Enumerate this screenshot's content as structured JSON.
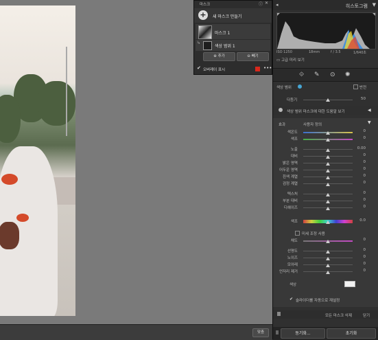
{
  "mask_panel": {
    "title": "마스크",
    "new_mask": "새 마스크 만들기",
    "mask1": "마스크 1",
    "sub_mask": "색상 범위 1",
    "add": "추가",
    "subtract": "빼기",
    "overlay_label": "오버레이 표시",
    "overlay_color": "#d8281c"
  },
  "histogram": {
    "title": "히스토그램",
    "iso": "ISO 1250",
    "focal": "18mm",
    "aperture": "f / 3.5",
    "shutter": "1/640초",
    "original": "고급 미리 보기"
  },
  "color_range": {
    "label": "색상 범위",
    "invert": "반전",
    "refine_label": "다듬기",
    "refine_value": "50",
    "help": "색상 범위 마스크에 대한 도움말 보기"
  },
  "effect": {
    "label": "효과",
    "preset": "사용자 정의",
    "sliders": [
      {
        "label": "색온도",
        "value": "0"
      },
      {
        "label": "색조",
        "value": "0"
      },
      {
        "label": "노출",
        "value": "0.00"
      },
      {
        "label": "대비",
        "value": "0"
      },
      {
        "label": "밝은 영역",
        "value": "0"
      },
      {
        "label": "어두운 영역",
        "value": "0"
      },
      {
        "label": "흰색 계열",
        "value": "0"
      },
      {
        "label": "검정 계열",
        "value": "0"
      },
      {
        "label": "텍스처",
        "value": "0"
      },
      {
        "label": "부분 대비",
        "value": "0"
      },
      {
        "label": "디헤이즈",
        "value": "0"
      },
      {
        "label": "색조",
        "value": "0.0"
      },
      {
        "label": "채도",
        "value": "0"
      },
      {
        "label": "선명도",
        "value": "0"
      },
      {
        "label": "노이즈",
        "value": "0"
      },
      {
        "label": "모아레",
        "value": "0"
      },
      {
        "label": "언저리 제거",
        "value": "0"
      }
    ],
    "fine_adjust": "미세 조정 사용",
    "color_label": "색상",
    "auto_hide": "슬라이더를 자동으로 재설정"
  },
  "footer": {
    "delete_all": "모든 마스크 삭제",
    "close": "닫기",
    "sync": "동기화...",
    "reset": "초기화"
  },
  "canvas": {
    "fit_button": "맞춤"
  }
}
